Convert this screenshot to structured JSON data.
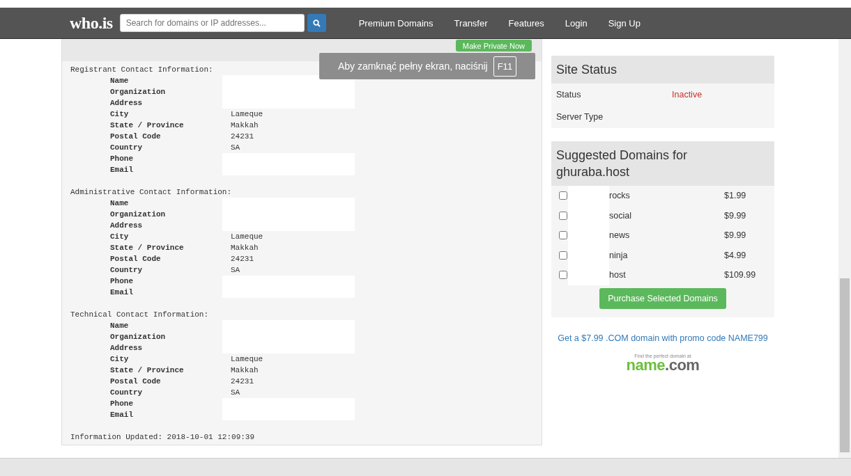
{
  "navbar": {
    "logo": "who.is",
    "search": {
      "placeholder": "Search for domains or IP addresses..."
    },
    "links": [
      "Premium Domains",
      "Transfer",
      "Features",
      "Login",
      "Sign Up"
    ]
  },
  "fullscreen_notice": {
    "text": "Aby zamknąć pełny ekran, naciśnij",
    "key": "F11"
  },
  "whois": {
    "private_button": "Make Private Now",
    "contacts": [
      {
        "heading": "Registrant Contact Information:",
        "fields": [
          {
            "label": "Name",
            "redacted": true
          },
          {
            "label": "Organization",
            "redacted": true
          },
          {
            "label": "Address",
            "redacted": true
          },
          {
            "label": "City",
            "value": "Lameque",
            "redacted": false
          },
          {
            "label": "State / Province",
            "value": "Makkah",
            "redacted": false
          },
          {
            "label": "Postal Code",
            "value": "24231",
            "redacted": false
          },
          {
            "label": "Country",
            "value": "SA",
            "redacted": false
          },
          {
            "label": "Phone",
            "redacted": true
          },
          {
            "label": "Email",
            "redacted": true
          }
        ]
      },
      {
        "heading": "Administrative Contact Information:",
        "fields": [
          {
            "label": "Name",
            "redacted": true
          },
          {
            "label": "Organization",
            "redacted": true
          },
          {
            "label": "Address",
            "redacted": true
          },
          {
            "label": "City",
            "value": "Lameque",
            "redacted": false
          },
          {
            "label": "State / Province",
            "value": "Makkah",
            "redacted": false
          },
          {
            "label": "Postal Code",
            "value": "24231",
            "redacted": false
          },
          {
            "label": "Country",
            "value": "SA",
            "redacted": false
          },
          {
            "label": "Phone",
            "redacted": true
          },
          {
            "label": "Email",
            "redacted": true
          }
        ]
      },
      {
        "heading": "Technical Contact Information:",
        "fields": [
          {
            "label": "Name",
            "redacted": true
          },
          {
            "label": "Organization",
            "redacted": true
          },
          {
            "label": "Address",
            "redacted": true
          },
          {
            "label": "City",
            "value": "Lameque",
            "redacted": false
          },
          {
            "label": "State / Province",
            "value": "Makkah",
            "redacted": false
          },
          {
            "label": "Postal Code",
            "value": "24231",
            "redacted": false
          },
          {
            "label": "Country",
            "value": "SA",
            "redacted": false
          },
          {
            "label": "Phone",
            "redacted": true
          },
          {
            "label": "Email",
            "redacted": true
          }
        ]
      }
    ],
    "updated": "Information Updated: 2018-10-01 12:09:39"
  },
  "site_status": {
    "title": "Site Status",
    "rows": [
      {
        "label": "Status",
        "value": "Inactive",
        "color": "#c9302c"
      },
      {
        "label": "Server Type"
      }
    ]
  },
  "suggested_domains": {
    "title": "Suggested Domains for ghuraba.host",
    "domains": [
      {
        "name": "rocks",
        "price": "$1.99",
        "checked": false
      },
      {
        "name": "social",
        "price": "$9.99",
        "checked": false
      },
      {
        "name": "news",
        "price": "$9.99",
        "checked": false
      },
      {
        "name": "ninja",
        "price": "$4.99",
        "checked": false
      },
      {
        "name": "host",
        "price": "$109.99",
        "checked": false
      }
    ],
    "button": "Purchase Selected Domains"
  },
  "promo": {
    "link": "Get a $7.99 .COM domain with promo code NAME799",
    "tagline": "Find the perfect domain at",
    "logo_name": "name",
    "logo_tld": ".com"
  }
}
